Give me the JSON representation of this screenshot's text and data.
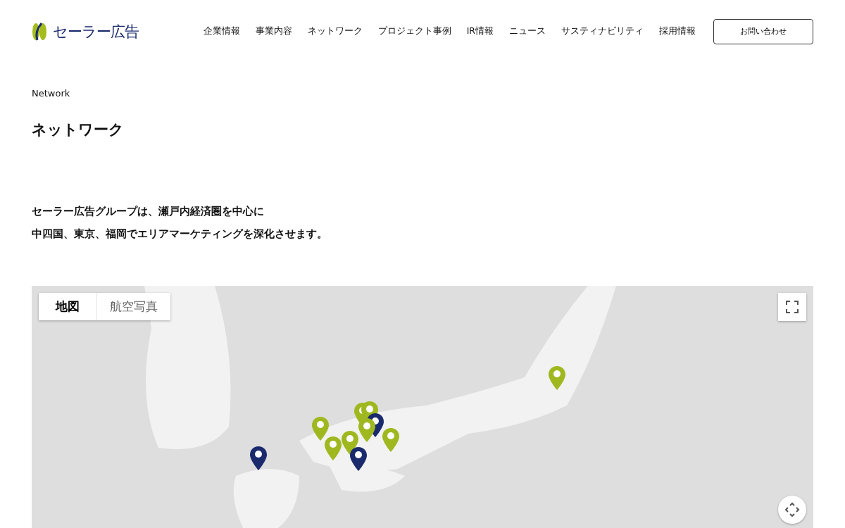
{
  "header": {
    "logo": "セーラー広告",
    "nav": [
      "企業情報",
      "事業内容",
      "ネットワーク",
      "プロジェクト事例",
      "IR情報",
      "ニュース",
      "サスティナビリティ",
      "採用情報"
    ],
    "contact_button": "お問い合わせ"
  },
  "section": {
    "eyebrow": "Network",
    "title": "ネットワーク",
    "lead": [
      "セーラー広告グループは、瀬戸内経済圏を中心に",
      "中四国、東京、福岡でエリアマーケティングを深化させます。"
    ]
  },
  "map": {
    "map_types": [
      {
        "label": "地図",
        "selected": true
      },
      {
        "label": "航空写真",
        "selected": false
      }
    ]
  }
}
